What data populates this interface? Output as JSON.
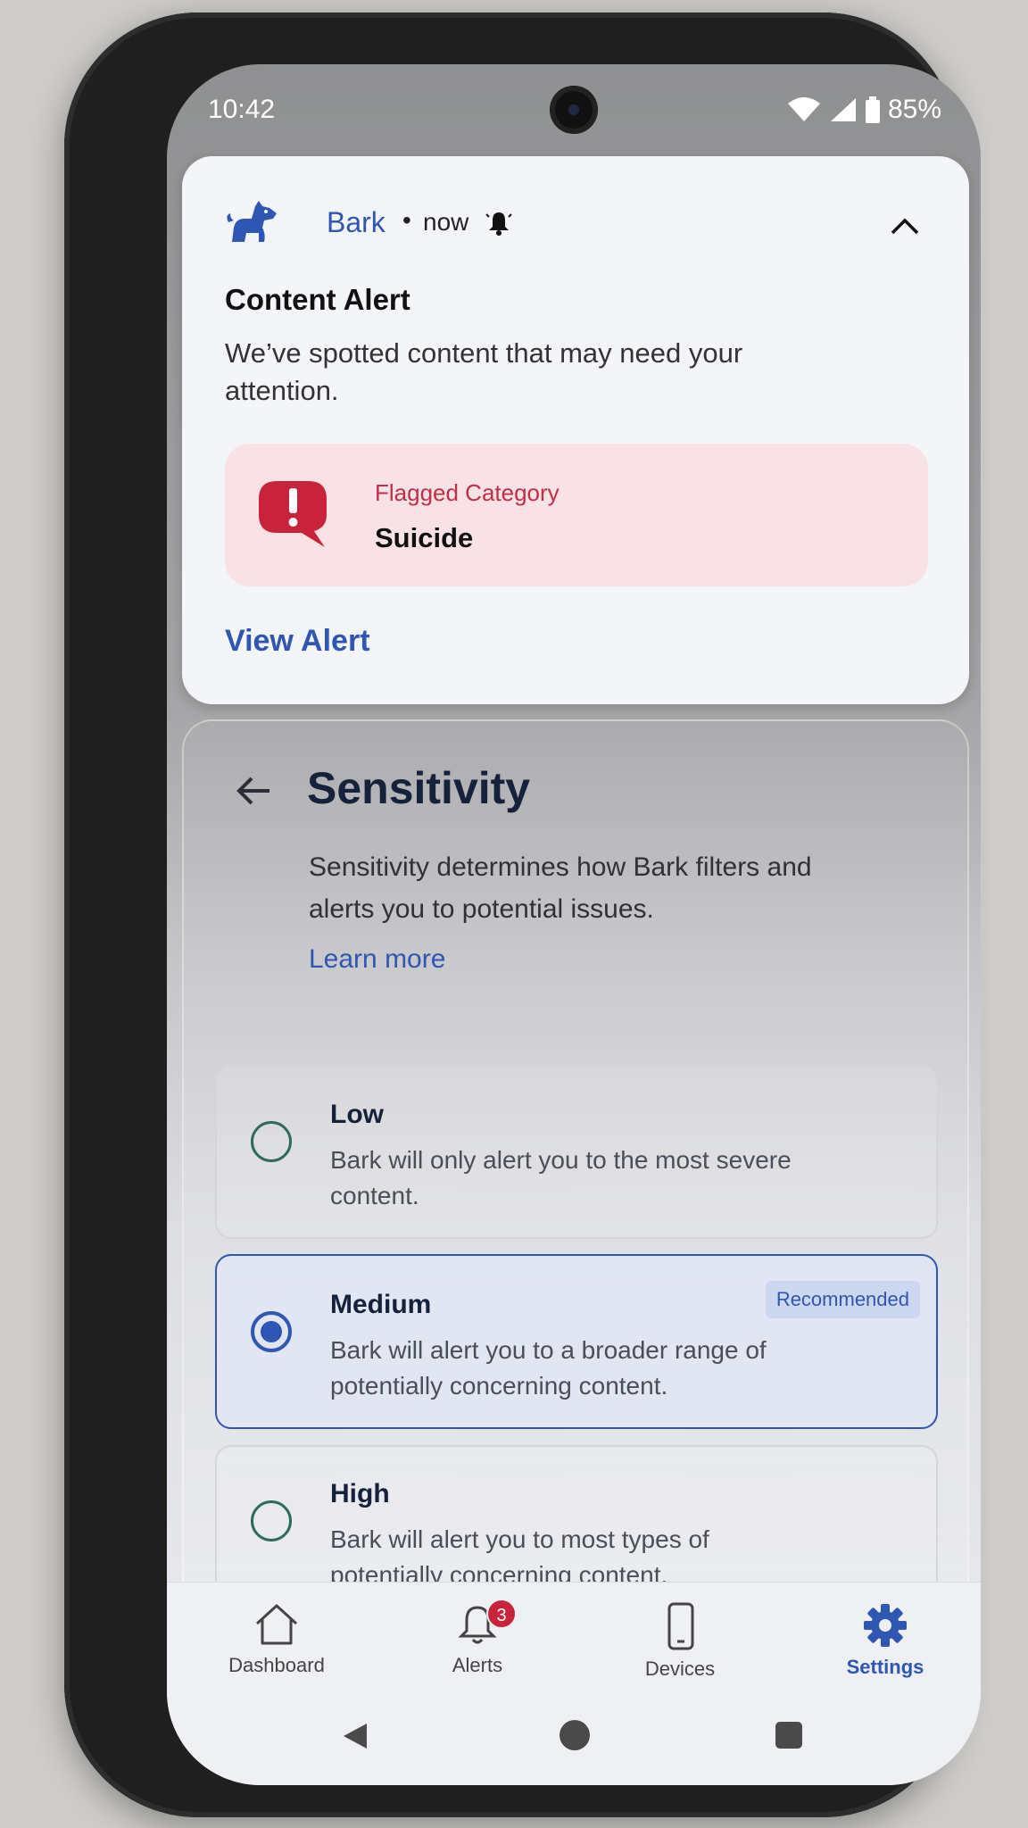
{
  "status_bar": {
    "time": "10:42",
    "battery": "85%"
  },
  "notification": {
    "app_name": "Bark",
    "separator": "•",
    "time": "now",
    "title": "Content Alert",
    "body": "We’ve spotted content that may need your attention.",
    "flag_label": "Flagged Category",
    "flag_value": "Suicide",
    "action": "View Alert"
  },
  "sensitivity": {
    "title": "Sensitivity",
    "description": "Sensitivity determines how Bark filters and alerts you to potential issues.",
    "learn_more": "Learn more",
    "options": [
      {
        "title": "Low",
        "description": "Bark will only alert you to the most severe content.",
        "selected": false
      },
      {
        "title": "Medium",
        "description": "Bark will alert you to a broader range of potentially concerning content.",
        "selected": true,
        "badge": "Recommended"
      },
      {
        "title": "High",
        "description": "Bark will alert you to most types of potentially concerning content.",
        "selected": false
      }
    ]
  },
  "bottom_nav": {
    "items": [
      {
        "label": "Dashboard",
        "icon": "home-icon"
      },
      {
        "label": "Alerts",
        "icon": "bell-icon",
        "badge": "3"
      },
      {
        "label": "Devices",
        "icon": "phone-icon"
      },
      {
        "label": "Settings",
        "icon": "gear-icon",
        "active": true
      }
    ]
  },
  "colors": {
    "accent": "#2f56b3",
    "alert_red": "#c8233b",
    "flag_bg": "#f8e2e5"
  }
}
